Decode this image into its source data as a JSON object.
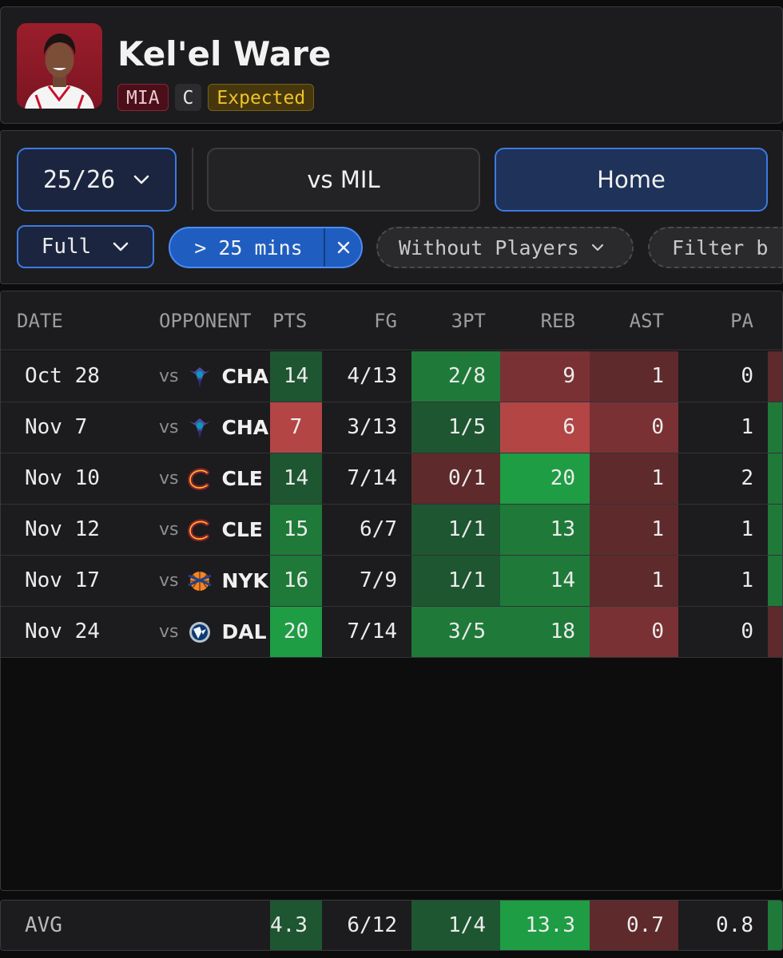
{
  "player": {
    "name": "Kel'el Ware",
    "team": "MIA",
    "position": "C",
    "status": "Expected"
  },
  "filters": {
    "season": "25/26",
    "opponent": "vs MIL",
    "location": "Home",
    "period": "Full",
    "minutes": "> 25 mins",
    "without_players": "Without Players",
    "filter_by": "Filter b"
  },
  "columns": {
    "date": "DATE",
    "opponent": "OPPONENT",
    "pts": "PTS",
    "fg": "FG",
    "three": "3PT",
    "reb": "REB",
    "ast": "AST",
    "pa": "PA"
  },
  "colors": {
    "dark_green": "#1e5631",
    "medium_green": "#1f7a39",
    "bright_green": "#1e9d44",
    "dark_red": "#5e2a2c",
    "medium_red": "#7a3134",
    "bright_red": "#b34545",
    "neutral": "#1c1c1e"
  },
  "games": [
    {
      "date": "Oct 28",
      "vs": "vs",
      "opp": "CHA",
      "logo": "hornets-logo",
      "pts": "14",
      "fg": "4/13",
      "three": "2/8",
      "reb": "9",
      "ast": "1",
      "pa": "0",
      "pts_c": "dark_green",
      "three_c": "medium_green",
      "reb_c": "medium_red",
      "ast_c": "dark_red",
      "edge_c": "dark_red"
    },
    {
      "date": "Nov 7",
      "vs": "vs",
      "opp": "CHA",
      "logo": "hornets-logo",
      "pts": "7",
      "fg": "3/13",
      "three": "1/5",
      "reb": "6",
      "ast": "0",
      "pa": "1",
      "pts_c": "bright_red",
      "three_c": "dark_green",
      "reb_c": "bright_red",
      "ast_c": "medium_red",
      "edge_c": "medium_green"
    },
    {
      "date": "Nov 10",
      "vs": "vs",
      "opp": "CLE",
      "logo": "cavaliers-logo",
      "pts": "14",
      "fg": "7/14",
      "three": "0/1",
      "reb": "20",
      "ast": "1",
      "pa": "2",
      "pts_c": "dark_green",
      "three_c": "dark_red",
      "reb_c": "bright_green",
      "ast_c": "dark_red",
      "edge_c": "medium_green"
    },
    {
      "date": "Nov 12",
      "vs": "vs",
      "opp": "CLE",
      "logo": "cavaliers-logo",
      "pts": "15",
      "fg": "6/7",
      "three": "1/1",
      "reb": "13",
      "ast": "1",
      "pa": "1",
      "pts_c": "medium_green",
      "three_c": "dark_green",
      "reb_c": "medium_green",
      "ast_c": "dark_red",
      "edge_c": "medium_green"
    },
    {
      "date": "Nov 17",
      "vs": "vs",
      "opp": "NYK",
      "logo": "knicks-logo",
      "pts": "16",
      "fg": "7/9",
      "three": "1/1",
      "reb": "14",
      "ast": "1",
      "pa": "1",
      "pts_c": "medium_green",
      "three_c": "dark_green",
      "reb_c": "medium_green",
      "ast_c": "dark_red",
      "edge_c": "medium_green"
    },
    {
      "date": "Nov 24",
      "vs": "vs",
      "opp": "DAL",
      "logo": "mavericks-logo",
      "pts": "20",
      "fg": "7/14",
      "three": "3/5",
      "reb": "18",
      "ast": "0",
      "pa": "0",
      "pts_c": "bright_green",
      "three_c": "medium_green",
      "reb_c": "medium_green",
      "ast_c": "medium_red",
      "edge_c": "dark_red"
    }
  ],
  "average": {
    "label": "AVG",
    "pts": "4.3",
    "fg": "6/12",
    "three": "1/4",
    "reb": "13.3",
    "ast": "0.7",
    "pa": "0.8",
    "pts_c": "dark_green",
    "three_c": "dark_green",
    "reb_c": "bright_green",
    "ast_c": "dark_red",
    "edge_c": "medium_green"
  }
}
